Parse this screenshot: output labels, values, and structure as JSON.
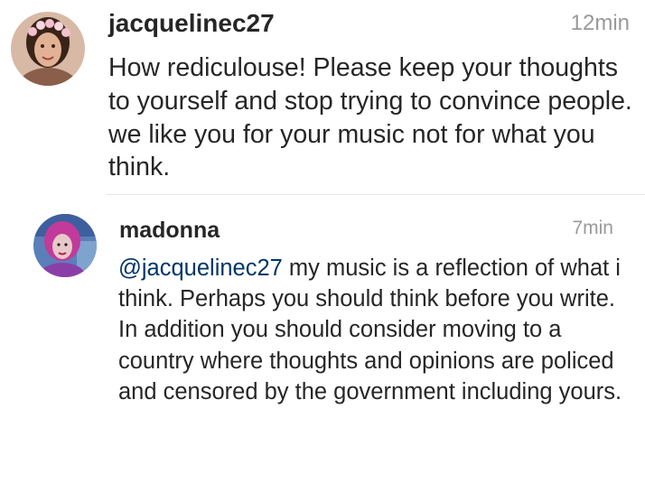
{
  "comments": [
    {
      "username": "jacquelinec27",
      "timestamp": "12min",
      "text": "How rediculouse! Please keep your thoughts to yourself and stop trying to convince people. we like you for your music not for what you think.",
      "avatar_icon": "profile-photo-icon"
    },
    {
      "username": "madonna",
      "timestamp": "7min",
      "mention": "@jacquelinec27",
      "text": " my music is a reflection of what i think. Perhaps you should think before you write. In addition you should consider moving to a country where thoughts and opinions are policed and censored by the government including yours.",
      "avatar_icon": "profile-photo-icon"
    }
  ],
  "colors": {
    "text": "#262626",
    "timestamp": "#999999",
    "mention": "#003569",
    "divider": "#e6e6e6"
  }
}
